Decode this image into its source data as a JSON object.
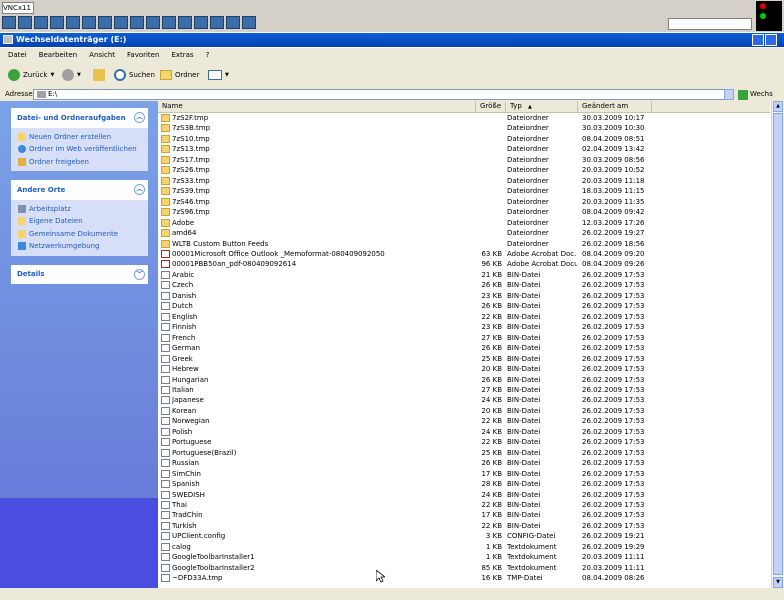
{
  "vnc": {
    "title": "VNCx11"
  },
  "window": {
    "title": "Wechseldatenträger (E:)"
  },
  "menu": [
    "Datei",
    "Bearbeiten",
    "Ansicht",
    "Favoriten",
    "Extras",
    "?"
  ],
  "toolbar": {
    "back": "Zurück",
    "search": "Suchen",
    "folders": "Ordner"
  },
  "address": {
    "label": "Adresse",
    "value": "E:\\",
    "go": "Wechs"
  },
  "tasks": {
    "title": "Datei- und Ordneraufgaben",
    "items": [
      "Neuen Ordner erstellen",
      "Ordner im Web veröffentlichen",
      "Ordner freigeben"
    ]
  },
  "places": {
    "title": "Andere Orte",
    "items": [
      "Arbeitsplatz",
      "Eigene Dateien",
      "Gemeinsame Dokumente",
      "Netzwerkumgebung"
    ]
  },
  "details": {
    "title": "Details"
  },
  "columns": {
    "name": "Name",
    "size": "Größe",
    "type": "Typ",
    "modified": "Geändert am"
  },
  "files": [
    {
      "icon": "folder",
      "name": "7zS2F.tmp",
      "size": "",
      "type": "Dateiordner",
      "modified": "30.03.2009 10:17"
    },
    {
      "icon": "folder",
      "name": "7zS3B.tmp",
      "size": "",
      "type": "Dateiordner",
      "modified": "30.03.2009 10:30"
    },
    {
      "icon": "folder",
      "name": "7zS10.tmp",
      "size": "",
      "type": "Dateiordner",
      "modified": "08.04.2009 08:51"
    },
    {
      "icon": "folder",
      "name": "7zS13.tmp",
      "size": "",
      "type": "Dateiordner",
      "modified": "02.04.2009 13:42"
    },
    {
      "icon": "folder",
      "name": "7zS17.tmp",
      "size": "",
      "type": "Dateiordner",
      "modified": "30.03.2009 08:56"
    },
    {
      "icon": "folder",
      "name": "7zS26.tmp",
      "size": "",
      "type": "Dateiordner",
      "modified": "20.03.2009 10:52"
    },
    {
      "icon": "folder",
      "name": "7zS33.tmp",
      "size": "",
      "type": "Dateiordner",
      "modified": "20.03.2009 11:18"
    },
    {
      "icon": "folder",
      "name": "7zS39.tmp",
      "size": "",
      "type": "Dateiordner",
      "modified": "18.03.2009 11:15"
    },
    {
      "icon": "folder",
      "name": "7zS46.tmp",
      "size": "",
      "type": "Dateiordner",
      "modified": "20.03.2009 11:35"
    },
    {
      "icon": "folder",
      "name": "7zS96.tmp",
      "size": "",
      "type": "Dateiordner",
      "modified": "08.04.2009 09:42"
    },
    {
      "icon": "folder",
      "name": "Adobe",
      "size": "",
      "type": "Dateiordner",
      "modified": "12.03.2009 17:26"
    },
    {
      "icon": "folder",
      "name": "amd64",
      "size": "",
      "type": "Dateiordner",
      "modified": "26.02.2009 19:27"
    },
    {
      "icon": "folder",
      "name": "WLTB Custom Button Feeds",
      "size": "",
      "type": "Dateiordner",
      "modified": "26.02.2009 18:56"
    },
    {
      "icon": "pdf",
      "name": "00001Microsoft Office Outlook _Memoformat-080409092050",
      "size": "63 KB",
      "type": "Adobe Acrobat Doc...",
      "modified": "08.04.2009 09:20"
    },
    {
      "icon": "pdf",
      "name": "00001PBB50an_pdf-080409092614",
      "size": "96 KB",
      "type": "Adobe Acrobat Document",
      "modified": "08.04.2009 09:26"
    },
    {
      "icon": "file",
      "name": "Arabic",
      "size": "21 KB",
      "type": "BIN-Datei",
      "modified": "26.02.2009 17:53"
    },
    {
      "icon": "file",
      "name": "Czech",
      "size": "26 KB",
      "type": "BIN-Datei",
      "modified": "26.02.2009 17:53"
    },
    {
      "icon": "file",
      "name": "Danish",
      "size": "23 KB",
      "type": "BIN-Datei",
      "modified": "26.02.2009 17:53"
    },
    {
      "icon": "file",
      "name": "Dutch",
      "size": "26 KB",
      "type": "BIN-Datei",
      "modified": "26.02.2009 17:53"
    },
    {
      "icon": "file",
      "name": "English",
      "size": "22 KB",
      "type": "BIN-Datei",
      "modified": "26.02.2009 17:53"
    },
    {
      "icon": "file",
      "name": "Finnish",
      "size": "23 KB",
      "type": "BIN-Datei",
      "modified": "26.02.2009 17:53"
    },
    {
      "icon": "file",
      "name": "French",
      "size": "27 KB",
      "type": "BIN-Datei",
      "modified": "26.02.2009 17:53"
    },
    {
      "icon": "file",
      "name": "German",
      "size": "26 KB",
      "type": "BIN-Datei",
      "modified": "26.02.2009 17:53"
    },
    {
      "icon": "file",
      "name": "Greek",
      "size": "25 KB",
      "type": "BIN-Datei",
      "modified": "26.02.2009 17:53"
    },
    {
      "icon": "file",
      "name": "Hebrew",
      "size": "20 KB",
      "type": "BIN-Datei",
      "modified": "26.02.2009 17:53"
    },
    {
      "icon": "file",
      "name": "Hungarian",
      "size": "26 KB",
      "type": "BIN-Datei",
      "modified": "26.02.2009 17:53"
    },
    {
      "icon": "file",
      "name": "Italian",
      "size": "27 KB",
      "type": "BIN-Datei",
      "modified": "26.02.2009 17:53"
    },
    {
      "icon": "file",
      "name": "Japanese",
      "size": "24 KB",
      "type": "BIN-Datei",
      "modified": "26.02.2009 17:53"
    },
    {
      "icon": "file",
      "name": "Korean",
      "size": "20 KB",
      "type": "BIN-Datei",
      "modified": "26.02.2009 17:53"
    },
    {
      "icon": "file",
      "name": "Norwegian",
      "size": "22 KB",
      "type": "BIN-Datei",
      "modified": "26.02.2009 17:53"
    },
    {
      "icon": "file",
      "name": "Polish",
      "size": "24 KB",
      "type": "BIN-Datei",
      "modified": "26.02.2009 17:53"
    },
    {
      "icon": "file",
      "name": "Portuguese",
      "size": "22 KB",
      "type": "BIN-Datei",
      "modified": "26.02.2009 17:53"
    },
    {
      "icon": "file",
      "name": "Portuguese(Brazil)",
      "size": "25 KB",
      "type": "BIN-Datei",
      "modified": "26.02.2009 17:53"
    },
    {
      "icon": "file",
      "name": "Russian",
      "size": "26 KB",
      "type": "BIN-Datei",
      "modified": "26.02.2009 17:53"
    },
    {
      "icon": "file",
      "name": "SimChin",
      "size": "17 KB",
      "type": "BIN-Datei",
      "modified": "26.02.2009 17:53"
    },
    {
      "icon": "file",
      "name": "Spanish",
      "size": "28 KB",
      "type": "BIN-Datei",
      "modified": "26.02.2009 17:53"
    },
    {
      "icon": "file",
      "name": "SWEDISH",
      "size": "24 KB",
      "type": "BIN-Datei",
      "modified": "26.02.2009 17:53"
    },
    {
      "icon": "file",
      "name": "Thai",
      "size": "22 KB",
      "type": "BIN-Datei",
      "modified": "26.02.2009 17:53"
    },
    {
      "icon": "file",
      "name": "TradChin",
      "size": "17 KB",
      "type": "BIN-Datei",
      "modified": "26.02.2009 17:53"
    },
    {
      "icon": "file",
      "name": "Turkish",
      "size": "22 KB",
      "type": "BIN-Datei",
      "modified": "26.02.2009 17:53"
    },
    {
      "icon": "file",
      "name": "UPClient.config",
      "size": "3 KB",
      "type": "CONFIG-Datei",
      "modified": "26.02.2009 19:21"
    },
    {
      "icon": "file",
      "name": "calog",
      "size": "1 KB",
      "type": "Textdokument",
      "modified": "26.02.2009 19:29"
    },
    {
      "icon": "file",
      "name": "GoogleToolbarInstaller1",
      "size": "1 KB",
      "type": "Textdokument",
      "modified": "20.03.2009 11:11"
    },
    {
      "icon": "file",
      "name": "GoogleToolbarInstaller2",
      "size": "85 KB",
      "type": "Textdokument",
      "modified": "20.03.2009 11:11"
    },
    {
      "icon": "file",
      "name": "~DFD33A.tmp",
      "size": "16 KB",
      "type": "TMP-Datei",
      "modified": "08.04.2009 08:26"
    }
  ]
}
